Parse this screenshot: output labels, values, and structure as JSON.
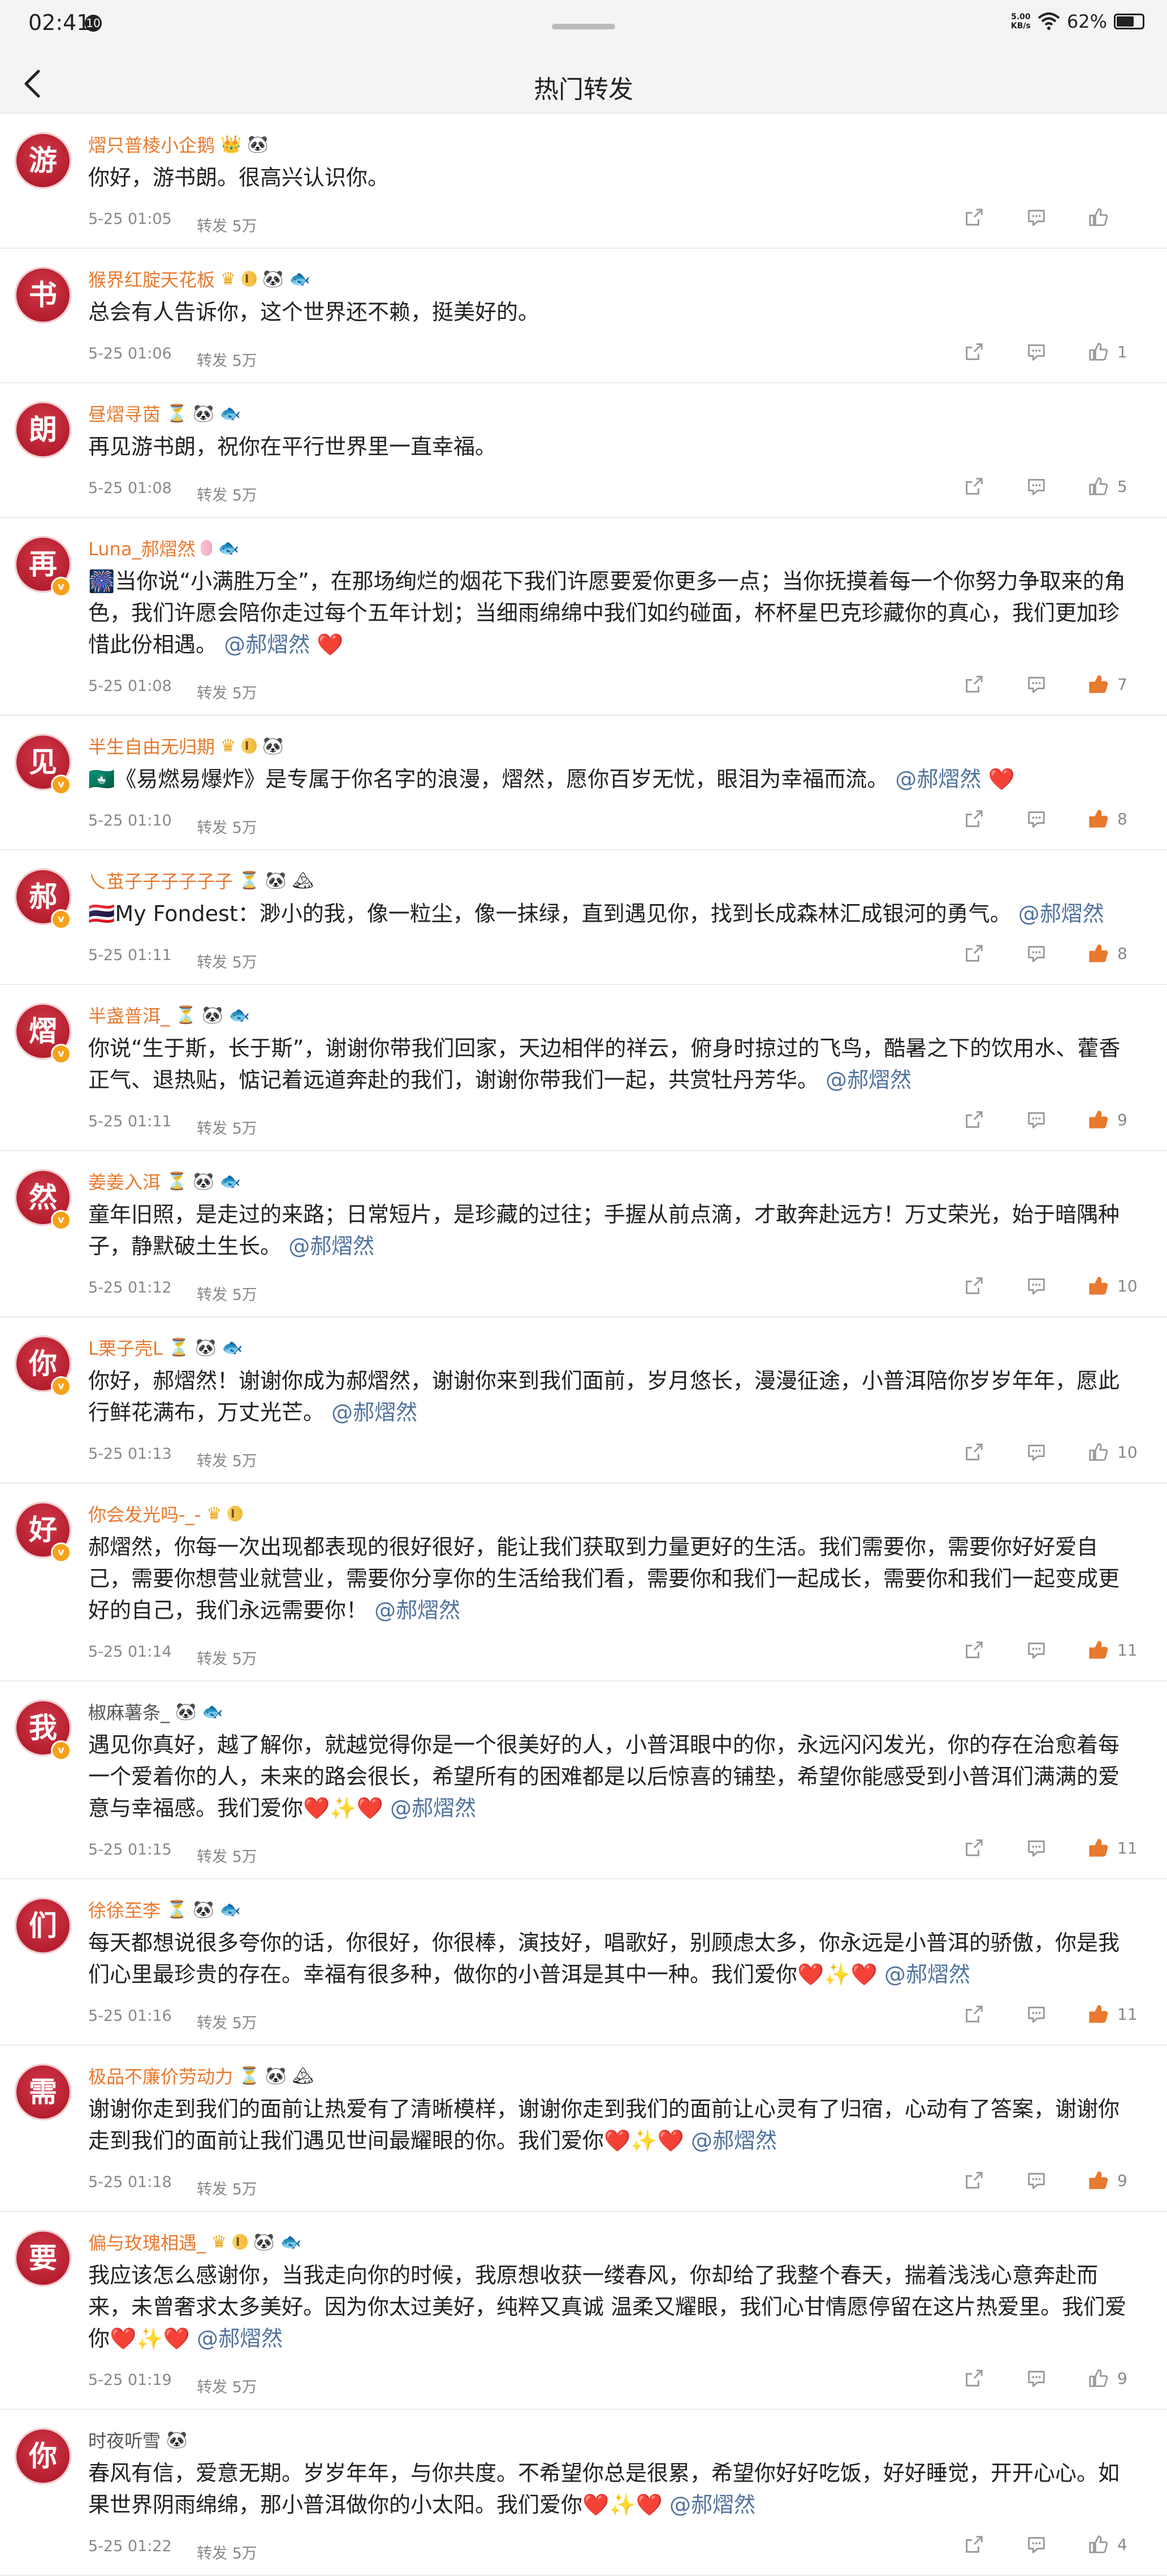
{
  "status_bar": {
    "time": "02:41",
    "notification_icon": "10",
    "net_speed_top": "5.00",
    "net_speed_bottom": "KB/s",
    "battery": "62%"
  },
  "nav": {
    "title": "热门转发",
    "back_icon": "back-arrow-icon"
  },
  "colors": {
    "username": "#e8792e",
    "mention": "#51739e",
    "like_active": "#e8792e",
    "heart": "#e02b2b"
  },
  "posts": [
    {
      "avatar": "游",
      "name": "熠只普棱小企鹅",
      "time": "5-25 01:05",
      "repost": "转发 5万",
      "likes": "",
      "liked": false,
      "c1": "你好，游书朗。很高兴认识你。",
      "mention": "",
      "tail": ""
    },
    {
      "avatar": "书",
      "name": "猴界红腚天花板",
      "time": "5-25 01:06",
      "repost": "转发 5万",
      "likes": "1",
      "liked": false,
      "c1": "总会有人告诉你，这个世界还不赖，挺美好的。",
      "mention": "",
      "tail": ""
    },
    {
      "avatar": "朗",
      "name": "昼熠寻茵",
      "time": "5-25 01:08",
      "repost": "转发 5万",
      "likes": "5",
      "liked": false,
      "c1": "再见游书朗，祝你在平行世界里一直幸福。",
      "mention": "",
      "tail": ""
    },
    {
      "avatar": "再",
      "name": "Luna_郝熠然",
      "time": "5-25 01:08",
      "repost": "转发 5万",
      "likes": "7",
      "liked": true,
      "c1": "🎆当你说“小满胜万全”，在那场绚烂的烟花下我们许愿要爱你更多一点；当你抚摸着每一个你努力争取来的角色，我们许愿会陪你走过每个五年计划；当细雨绵绵中我们如约碰面，杯杯星巴克珍藏你的真心，我们更加珍惜此份相遇。",
      "mention": "@郝熠然",
      "tail": "❤️"
    },
    {
      "avatar": "见",
      "name": "半生自由无归期",
      "time": "5-25 01:10",
      "repost": "转发 5万",
      "likes": "8",
      "liked": true,
      "c1": "🇲🇴《易燃易爆炸》是专属于你名字的浪漫，熠然，愿你百岁无忧，眼泪为幸福而流。",
      "mention": "@郝熠然",
      "tail": "❤️"
    },
    {
      "avatar": "郝",
      "name": "乀茧子子子子子子",
      "time": "5-25 01:11",
      "repost": "转发 5万",
      "likes": "8",
      "liked": true,
      "c1": "🇹🇭My Fondest：渺小的我，像一粒尘，像一抹绿，直到遇见你，找到长成森林汇成银河的勇气。",
      "mention": "@郝熠然",
      "tail": ""
    },
    {
      "avatar": "熠",
      "name": "半盏普洱_",
      "time": "5-25 01:11",
      "repost": "转发 5万",
      "likes": "9",
      "liked": true,
      "c1": "你说“生于斯，长于斯”，谢谢你带我们回家，天边相伴的祥云，俯身时掠过的飞鸟，酷暑之下的饮用水、藿香正气、退热贴，惦记着远道奔赴的我们，谢谢你带我们一起，共赏牡丹芳华。",
      "mention": "@郝熠然",
      "tail": ""
    },
    {
      "avatar": "然",
      "name": "姜姜入洱",
      "time": "5-25 01:12",
      "repost": "转发 5万",
      "likes": "10",
      "liked": true,
      "c1": "童年旧照，是走过的来路；日常短片，是珍藏的过往；手握从前点滴，才敢奔赴远方！万丈荣光，始于暗隅种子，静默破土生长。",
      "mention": "@郝熠然",
      "tail": ""
    },
    {
      "avatar": "你",
      "name": "L栗子壳L",
      "time": "5-25 01:13",
      "repost": "转发 5万",
      "likes": "10",
      "liked": false,
      "c1": "你好，郝熠然！谢谢你成为郝熠然，谢谢你来到我们面前，岁月悠长，漫漫征途，小普洱陪你岁岁年年，愿此行鲜花满布，万丈光芒。",
      "mention": "@郝熠然",
      "tail": ""
    },
    {
      "avatar": "好",
      "name": "你会发光吗-_-",
      "time": "5-25 01:14",
      "repost": "转发 5万",
      "likes": "11",
      "liked": true,
      "c1": "郝熠然，你每一次出现都表现的很好很好，能让我们获取到力量更好的生活。我们需要你，需要你好好爱自己，需要你想营业就营业，需要你分享你的生活给我们看，需要你和我们一起成长，需要你和我们一起变成更好的自己，我们永远需要你！",
      "mention": "@郝熠然",
      "tail": ""
    },
    {
      "avatar": "我",
      "name": "椒麻薯条_",
      "time": "5-25 01:15",
      "repost": "转发 5万",
      "likes": "11",
      "liked": true,
      "c1": "遇见你真好，越了解你，就越觉得你是一个很美好的人，小普洱眼中的你，永远闪闪发光，你的存在治愈着每一个爱着你的人，未来的路会很长，希望所有的困难都是以后惊喜的铺垫，希望你能感受到小普洱们满满的爱意与幸福感。我们爱你❤️✨❤️",
      "mention": "@郝熠然",
      "tail": ""
    },
    {
      "avatar": "们",
      "name": "徐徐至李",
      "time": "5-25 01:16",
      "repost": "转发 5万",
      "likes": "11",
      "liked": true,
      "c1": "每天都想说很多夸你的话，你很好，你很棒，演技好，唱歌好，别顾虑太多，你永远是小普洱的骄傲，你是我们心里最珍贵的存在。幸福有很多种，做你的小普洱是其中一种。我们爱你❤️✨❤️",
      "mention": "@郝熠然",
      "tail": ""
    },
    {
      "avatar": "需",
      "name": "极品不廉价劳动力",
      "time": "5-25 01:18",
      "repost": "转发 5万",
      "likes": "9",
      "liked": true,
      "c1": "谢谢你走到我们的面前让热爱有了清晰模样，谢谢你走到我们的面前让心灵有了归宿，心动有了答案，谢谢你走到我们的面前让我们遇见世间最耀眼的你。我们爱你❤️✨❤️",
      "mention": "@郝熠然",
      "tail": ""
    },
    {
      "avatar": "要",
      "name": "偏与玫瑰相遇_",
      "time": "5-25 01:19",
      "repost": "转发 5万",
      "likes": "9",
      "liked": false,
      "c1": "我应该怎么感谢你，当我走向你的时候，我原想收获一缕春风，你却给了我整个春天，揣着浅浅心意奔赴而来，未曾奢求太多美好。因为你太过美好，纯粹又真诚 温柔又耀眼，我们心甘情愿停留在这片热爱里。我们爱你❤️✨❤️",
      "mention": "@郝熠然",
      "tail": ""
    },
    {
      "avatar": "你",
      "name": "时夜听雪",
      "time": "5-25 01:22",
      "repost": "转发 5万",
      "likes": "4",
      "liked": false,
      "c1": "春风有信，爱意无期。岁岁年年，与你共度。不希望你总是很累，希望你好好吃饭，好好睡觉，开开心心。如果世界阴雨绵绵，那小普洱做你的小太阳。我们爱你❤️✨❤️",
      "mention": "@郝熠然",
      "tail": ""
    }
  ]
}
